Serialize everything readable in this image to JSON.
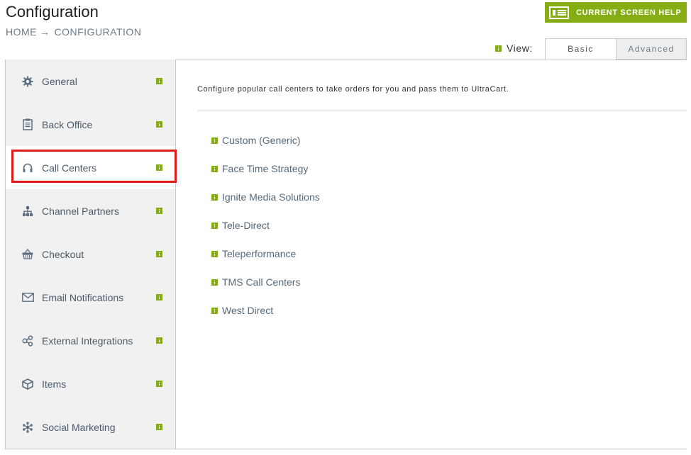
{
  "header": {
    "title": "Configuration",
    "breadcrumb": {
      "home": "HOME",
      "separator": "→",
      "current": "CONFIGURATION"
    },
    "help_button": {
      "label": "CURRENT SCREEN HELP",
      "icon": "screen-help-icon",
      "color": "#87ad14"
    }
  },
  "view": {
    "label": "View:",
    "tabs": [
      {
        "label": "Basic",
        "selected": true
      },
      {
        "label": "Advanced",
        "selected": false
      }
    ]
  },
  "sidebar": {
    "items": [
      {
        "label": "General",
        "icon": "gear-icon"
      },
      {
        "label": "Back Office",
        "icon": "clipboard-icon"
      },
      {
        "label": "Call Centers",
        "icon": "headset-icon",
        "active": true
      },
      {
        "label": "Channel Partners",
        "icon": "org-chart-icon"
      },
      {
        "label": "Checkout",
        "icon": "basket-icon"
      },
      {
        "label": "Email Notifications",
        "icon": "envelope-icon"
      },
      {
        "label": "External Integrations",
        "icon": "share-icon"
      },
      {
        "label": "Items",
        "icon": "box-icon"
      },
      {
        "label": "Social Marketing",
        "icon": "asterisk-icon"
      }
    ]
  },
  "main": {
    "description": "Configure popular call centers to take orders for you and pass them to UltraCart.",
    "call_centers": [
      "Custom (Generic)",
      "Face Time Strategy",
      "Ignite Media Solutions",
      "Tele-Direct",
      "Teleperformance",
      "TMS Call Centers",
      "West Direct"
    ]
  },
  "colors": {
    "accent": "#87ad14",
    "highlight": "#e11a1a",
    "link": "#55697a"
  }
}
